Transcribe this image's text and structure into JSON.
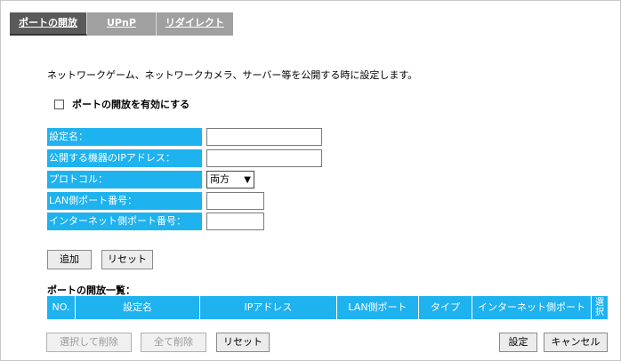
{
  "tabs": [
    "ポートの開放",
    "UPnP",
    "リダイレクト"
  ],
  "description": "ネットワークゲーム、ネットワークカメラ、サーバー等を公開する時に設定します。",
  "enable_label": "ポートの開放を有効にする",
  "form": {
    "name_label": "設定名：",
    "ip_label": "公開する機器のIPアドレス：",
    "protocol_label": "プロトコル：",
    "protocol_value": "両方",
    "lan_port_label": "LAN側ポート番号：",
    "wan_port_label": "インターネット側ポート番号："
  },
  "buttons": {
    "add": "追加",
    "reset": "リセット",
    "delete_selected": "選択して削除",
    "delete_all": "全て削除",
    "reset2": "リセット",
    "apply": "設定",
    "cancel": "キャンセル"
  },
  "list": {
    "title": "ポートの開放一覧：",
    "columns": [
      "NO.",
      "設定名",
      "IPアドレス",
      "LAN側ポート",
      "タイプ",
      "インターネット側ポート",
      "選択"
    ]
  },
  "colors": {
    "accent": "#1eb2ef",
    "tab_active": "#5a5a5a",
    "tab_inactive": "#a0a0a0"
  }
}
